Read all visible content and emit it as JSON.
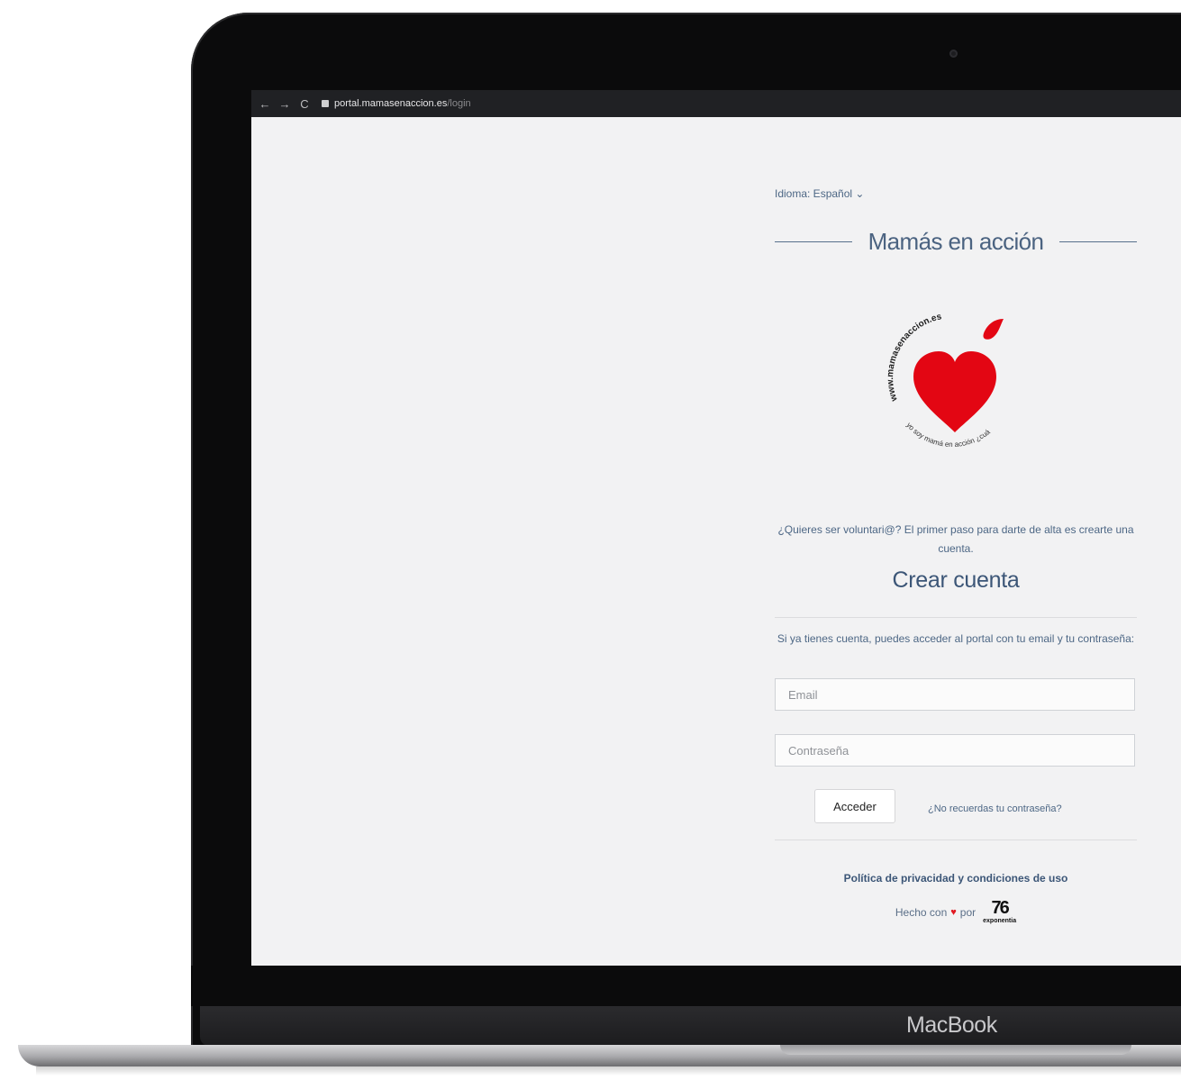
{
  "device": {
    "brand_label": "MacBook"
  },
  "browser": {
    "nav": {
      "back": "←",
      "forward": "→",
      "reload": "C"
    },
    "url_host": "portal.mamasenaccion.es",
    "url_path": "/login"
  },
  "page": {
    "language_label": "Idioma: Español ⌄",
    "title": "Mamás en acción",
    "logo": {
      "arc_text_top": "www.mamasenaccion.es",
      "arc_text_bottom": "yo soy mamá en acción ¿cuál es tu súper poder?",
      "heart_color": "#e30613"
    },
    "intro_text": "¿Quieres ser voluntari@? El primer paso para darte de alta es crearte una cuenta.",
    "create_account": "Crear cuenta",
    "login_info": "Si ya tienes cuenta, puedes acceder al portal con tu email y tu contraseña:",
    "email_placeholder": "Email",
    "password_placeholder": "Contraseña",
    "submit_label": "Acceder",
    "forgot_label": "¿No recuerdas tu contraseña?",
    "privacy_label": "Política de privacidad y condiciones de uso",
    "made_with_prefix": "Hecho con",
    "made_with_heart": "♥",
    "made_with_suffix": "por",
    "exponentia_mark": "76",
    "exponentia_word": "exponentia"
  },
  "colors": {
    "accent": "#3c5677",
    "heart": "#e30613",
    "screen_bg": "#f2f2f3"
  }
}
